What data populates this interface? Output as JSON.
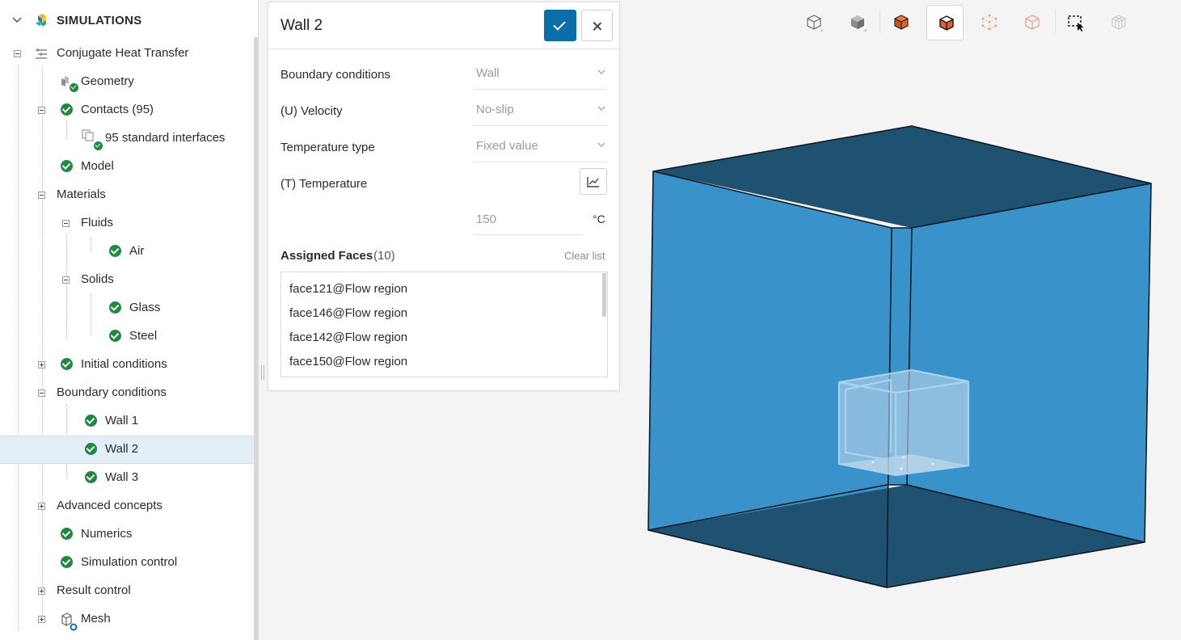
{
  "tree": {
    "header": "SIMULATIONS",
    "items": [
      {
        "label": "Conjugate Heat Transfer"
      },
      {
        "label": "Geometry"
      },
      {
        "label": "Contacts (95)"
      },
      {
        "label": "95 standard interfaces"
      },
      {
        "label": "Model"
      },
      {
        "label": "Materials"
      },
      {
        "label": "Fluids"
      },
      {
        "label": "Air"
      },
      {
        "label": "Solids"
      },
      {
        "label": "Glass"
      },
      {
        "label": "Steel"
      },
      {
        "label": "Initial conditions"
      },
      {
        "label": "Boundary conditions"
      },
      {
        "label": "Wall 1"
      },
      {
        "label": "Wall 2"
      },
      {
        "label": "Wall 3"
      },
      {
        "label": "Advanced concepts"
      },
      {
        "label": "Numerics"
      },
      {
        "label": "Simulation control"
      },
      {
        "label": "Result control"
      },
      {
        "label": "Mesh"
      }
    ]
  },
  "panel": {
    "title": "Wall 2",
    "boundary_conditions": {
      "label": "Boundary conditions",
      "value": "Wall"
    },
    "velocity": {
      "label": "(U) Velocity",
      "value": "No-slip"
    },
    "temperature_type": {
      "label": "Temperature type",
      "value": "Fixed value"
    },
    "temperature": {
      "label": "(T) Temperature",
      "value": "150",
      "unit": "°C"
    },
    "assigned_faces": {
      "title": "Assigned Faces",
      "count": "(10)",
      "clear_label": "Clear list",
      "faces": [
        "face121@Flow region",
        "face146@Flow region",
        "face142@Flow region",
        "face150@Flow region"
      ]
    }
  },
  "colors": {
    "accent": "#0a6ea8",
    "check_green": "#1e8a3e",
    "selection": "#e2eff7",
    "box_face": "#3a92cb",
    "box_dark": "#1f5270",
    "icon_orange": "#e0622a"
  }
}
